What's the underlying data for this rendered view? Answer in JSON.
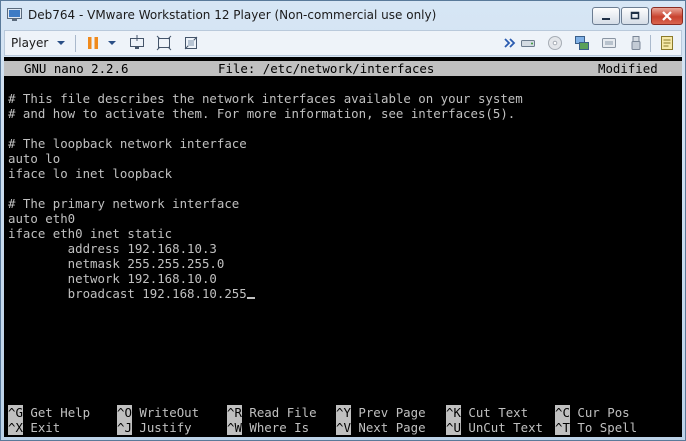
{
  "window": {
    "title": "Deb764 - VMware Workstation 12 Player (Non-commercial use only)"
  },
  "toolbar": {
    "player_label": "Player",
    "icons": [
      "pause-icon",
      "send-ctrl-alt-del-icon",
      "fit-guest-icon",
      "unity-icon",
      "forward-icon",
      "hdd-icon",
      "cd-icon",
      "network-icon",
      "sound-icon",
      "usb-icon",
      "message-log-icon"
    ]
  },
  "nano": {
    "header": {
      "version": "GNU nano 2.2.6",
      "file": "File: /etc/network/interfaces",
      "status": "Modified"
    },
    "lines": [
      "# This file describes the network interfaces available on your system",
      "# and how to activate them. For more information, see interfaces(5).",
      "",
      "# The loopback network interface",
      "auto lo",
      "iface lo inet loopback",
      "",
      "# The primary network interface",
      "auto eth0",
      "iface eth0 inet static",
      "        address 192.168.10.3",
      "        netmask 255.255.255.0",
      "        network 192.168.10.0",
      "        broadcast 192.168.10.255"
    ],
    "shortcuts_row1": [
      {
        "key": "^G",
        "label": "Get Help"
      },
      {
        "key": "^O",
        "label": "WriteOut"
      },
      {
        "key": "^R",
        "label": "Read File"
      },
      {
        "key": "^Y",
        "label": "Prev Page"
      },
      {
        "key": "^K",
        "label": "Cut Text"
      },
      {
        "key": "^C",
        "label": "Cur Pos"
      }
    ],
    "shortcuts_row2": [
      {
        "key": "^X",
        "label": "Exit"
      },
      {
        "key": "^J",
        "label": "Justify"
      },
      {
        "key": "^W",
        "label": "Where Is"
      },
      {
        "key": "^V",
        "label": "Next Page"
      },
      {
        "key": "^U",
        "label": "UnCut Text"
      },
      {
        "key": "^T",
        "label": "To Spell"
      }
    ]
  }
}
